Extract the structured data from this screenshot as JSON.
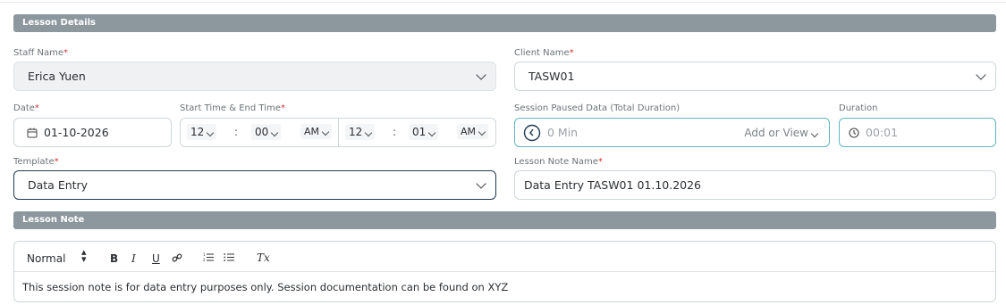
{
  "sections": {
    "lesson_details": "Lesson Details",
    "lesson_note": "Lesson Note"
  },
  "staff": {
    "label": "Staff Name",
    "value": "Erica Yuen"
  },
  "client": {
    "label": "Client Name",
    "value": "TASW01"
  },
  "date": {
    "label": "Date",
    "value": "01-10-2026"
  },
  "time": {
    "label": "Start Time & End Time",
    "start_hour": "12",
    "start_min": "00",
    "start_ampm": "AM",
    "end_hour": "12",
    "end_min": "01",
    "end_ampm": "AM",
    "separator": ":"
  },
  "paused": {
    "label": "Session Paused Data (Total Duration)",
    "value": "0 Min",
    "action": "Add or View"
  },
  "duration": {
    "label": "Duration",
    "value": "00:01"
  },
  "template": {
    "label": "Template",
    "value": "Data Entry"
  },
  "note_name": {
    "label": "Lesson Note Name",
    "value": "Data Entry TASW01 01.10.2026"
  },
  "editor": {
    "format": "Normal",
    "bold": "B",
    "italic": "I",
    "underline": "U",
    "clear": "Tx",
    "content": "This session note is for data entry purposes only. Session documentation can be found on XYZ"
  },
  "required_mark": "*"
}
